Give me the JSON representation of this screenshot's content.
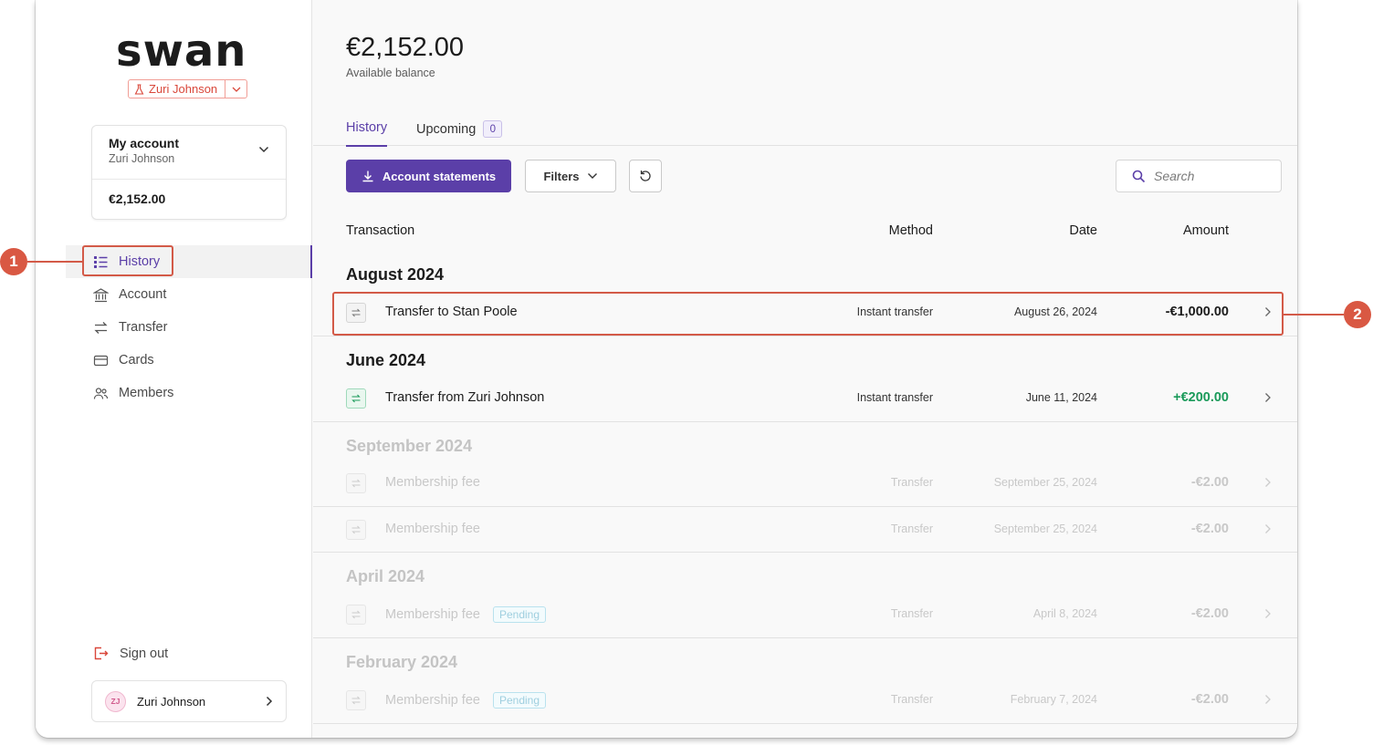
{
  "brand": {
    "logo_text": "swan"
  },
  "project": {
    "name": "Zuri Johnson"
  },
  "account_card": {
    "name": "My account",
    "holder": "Zuri Johnson",
    "balance": "€2,152.00"
  },
  "nav": {
    "items": [
      {
        "label": "History",
        "icon": "list-icon",
        "active": true
      },
      {
        "label": "Account",
        "icon": "bank-icon"
      },
      {
        "label": "Transfer",
        "icon": "transfer-arrows-icon"
      },
      {
        "label": "Cards",
        "icon": "card-icon"
      },
      {
        "label": "Members",
        "icon": "members-icon"
      }
    ],
    "sign_out": "Sign out"
  },
  "user": {
    "initials": "ZJ",
    "name": "Zuri Johnson"
  },
  "header": {
    "balance": "€2,152.00",
    "balance_label": "Available balance"
  },
  "tabs": {
    "history": "History",
    "upcoming": "Upcoming",
    "upcoming_count": "0"
  },
  "toolbar": {
    "statements_label": "Account statements",
    "filters_label": "Filters",
    "search_placeholder": "Search"
  },
  "table": {
    "columns": {
      "transaction": "Transaction",
      "method": "Method",
      "date": "Date",
      "amount": "Amount"
    },
    "groups": [
      {
        "title": "August 2024",
        "rows": [
          {
            "label": "Transfer to Stan Poole",
            "method": "Instant transfer",
            "date": "August 26, 2024",
            "amount": "-€1,000.00"
          }
        ]
      },
      {
        "title": "June 2024",
        "rows": [
          {
            "label": "Transfer from Zuri Johnson",
            "method": "Instant transfer",
            "date": "June 11, 2024",
            "amount": "+€200.00"
          }
        ]
      },
      {
        "title": "September 2024",
        "rows": [
          {
            "label": "Membership fee",
            "method": "Transfer",
            "date": "September 25, 2024",
            "amount": "-€2.00"
          },
          {
            "label": "Membership fee",
            "method": "Transfer",
            "date": "September 25, 2024",
            "amount": "-€2.00"
          }
        ]
      },
      {
        "title": "April 2024",
        "rows": [
          {
            "label": "Membership fee",
            "badge": "Pending",
            "method": "Transfer",
            "date": "April 8, 2024",
            "amount": "-€2.00"
          }
        ]
      },
      {
        "title": "February 2024",
        "rows": [
          {
            "label": "Membership fee",
            "badge": "Pending",
            "method": "Transfer",
            "date": "February 7, 2024",
            "amount": "-€2.00"
          }
        ]
      }
    ]
  },
  "callouts": [
    "1",
    "2"
  ],
  "colors": {
    "accent": "#5b3fa8",
    "callout": "#d95843",
    "positive": "#1a9a5a",
    "danger": "#d9473a"
  }
}
